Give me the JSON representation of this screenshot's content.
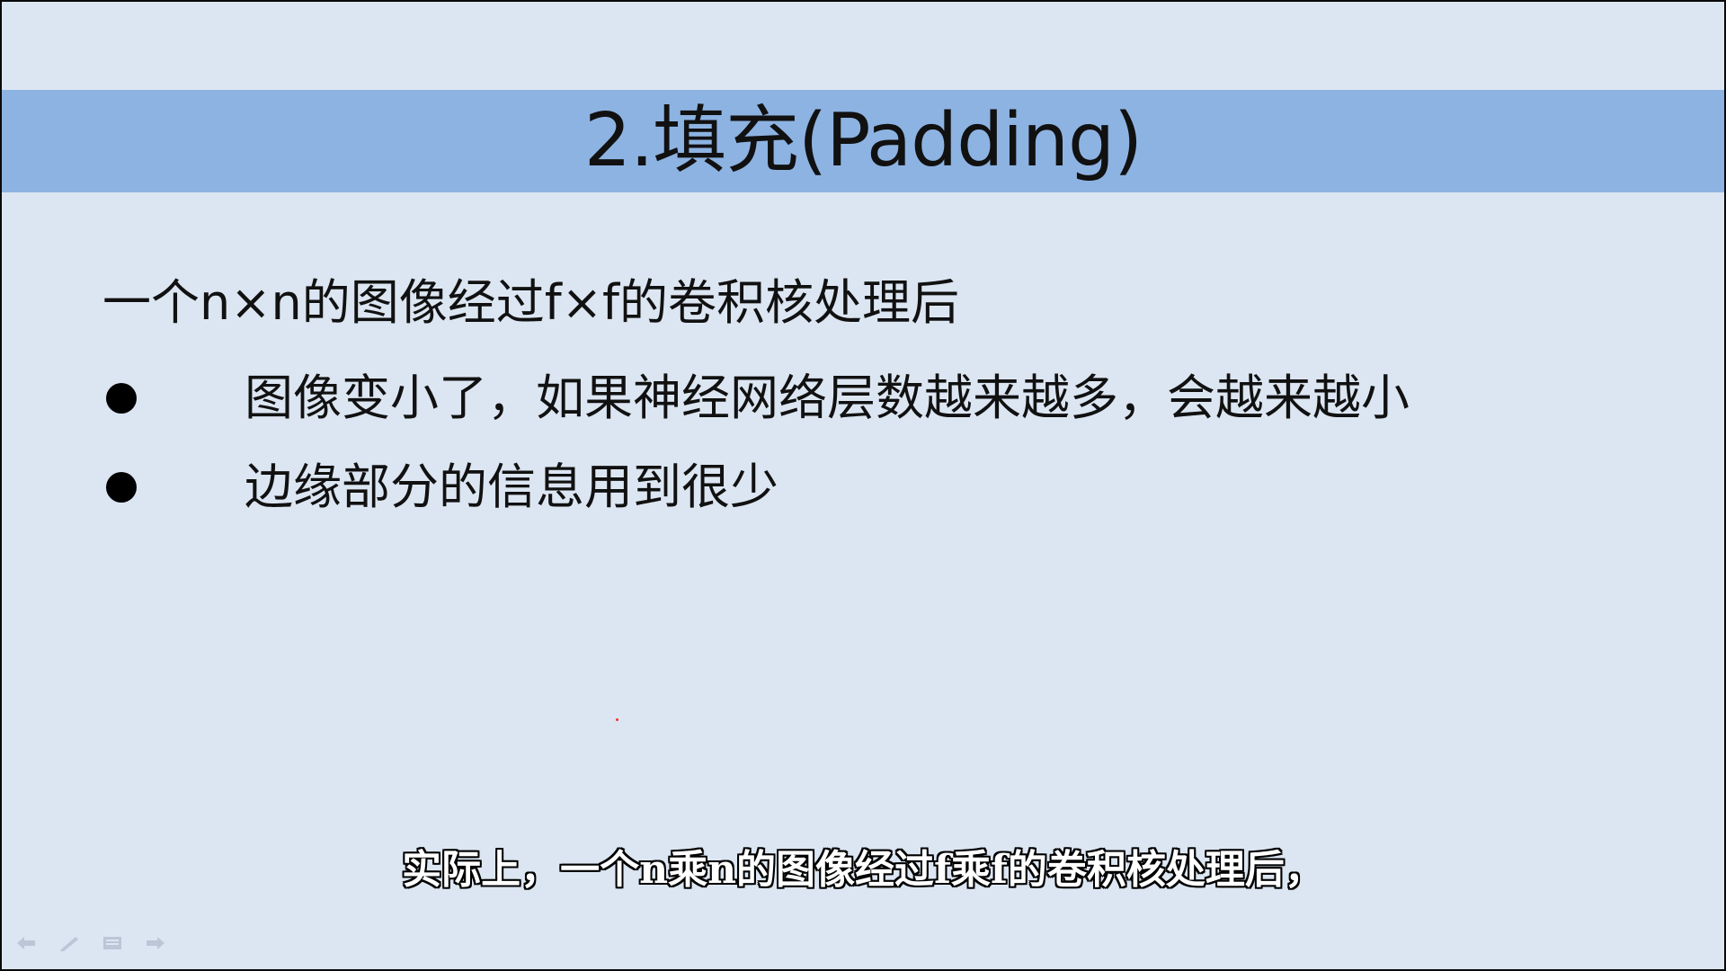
{
  "slide": {
    "title": "2.填充(Padding)",
    "intro": "一个n×n的图像经过f×f的卷积核处理后",
    "bullets": [
      {
        "text": "图像变小了，如果神经网络层数越来越多，会越来越小"
      },
      {
        "text": "边缘部分的信息用到很少"
      }
    ]
  },
  "subtitle": {
    "text": "实际上，一个n乘n的图像经过f乘f的卷积核处理后，"
  },
  "colors": {
    "slide_background": "#dce6f2",
    "title_bar": "#8db3e2",
    "text": "#111111",
    "pointer": "#ff2a2a"
  },
  "nav_controls": [
    {
      "icon": "previous-arrow-icon"
    },
    {
      "icon": "pen-icon"
    },
    {
      "icon": "menu-icon"
    },
    {
      "icon": "next-arrow-icon"
    }
  ]
}
